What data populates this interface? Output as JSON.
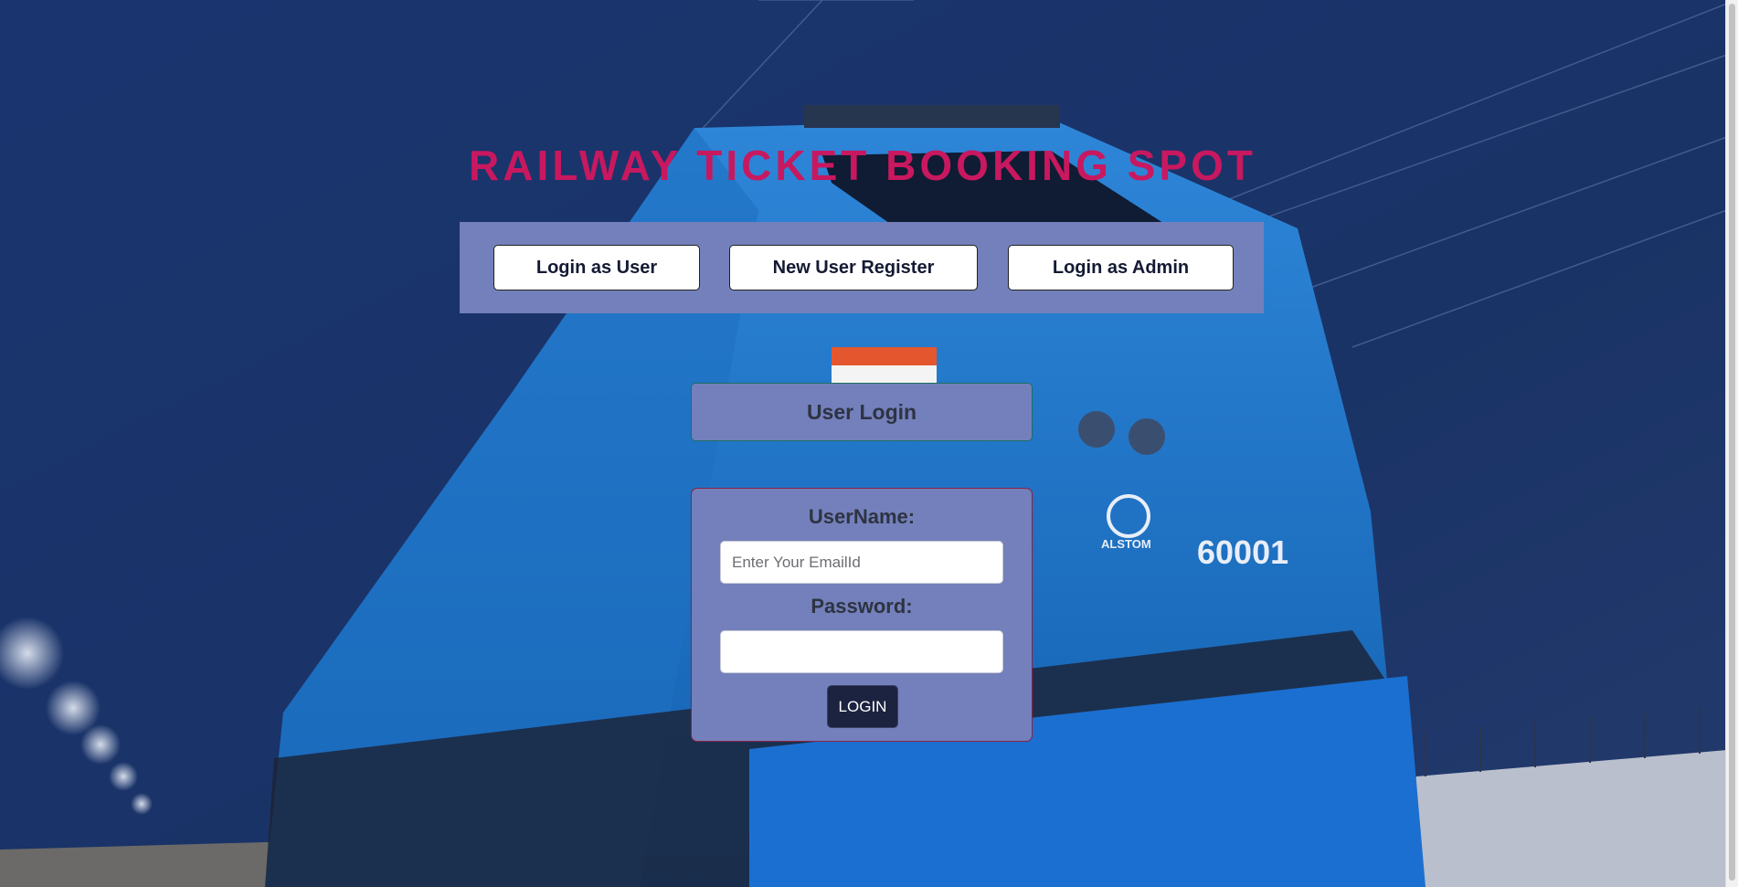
{
  "header": {
    "title": "RAILWAY TICKET BOOKING SPOT"
  },
  "nav": {
    "login_user": "Login as User",
    "register": "New User Register",
    "login_admin": "Login as Admin"
  },
  "login": {
    "heading": "User Login",
    "username_label": "UserName:",
    "username_placeholder": "Enter Your EmailId",
    "username_value": "",
    "password_label": "Password:",
    "password_value": "",
    "button_label": "LOGIN"
  },
  "background": {
    "subject": "train-photo",
    "locomotive_number": "60001",
    "maker": "ALSTOM"
  },
  "colors": {
    "title": "#c8185f",
    "panel": "#7380bb",
    "login_button": "#1c2340"
  }
}
